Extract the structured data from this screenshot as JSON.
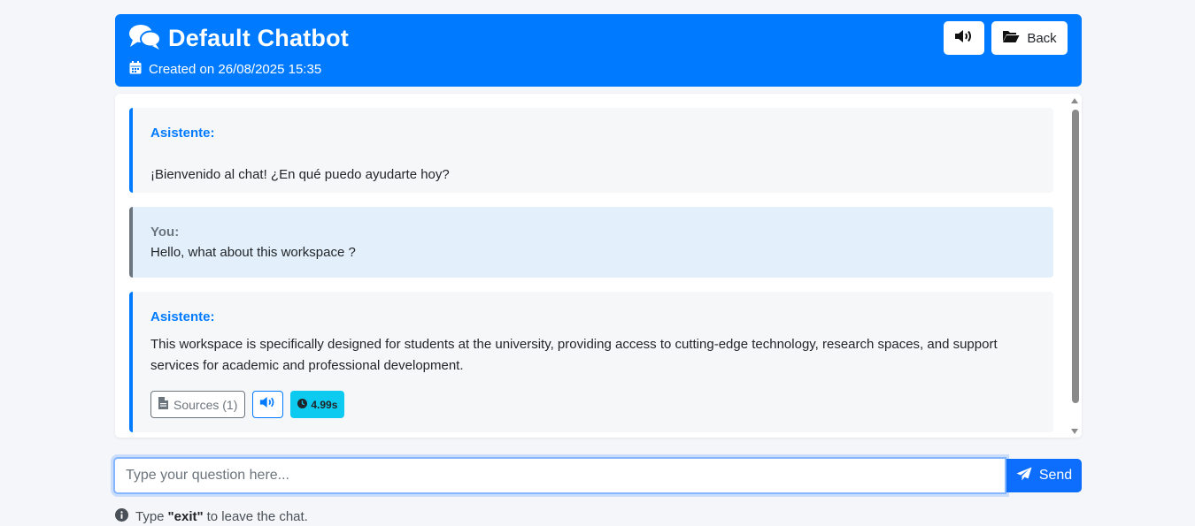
{
  "header": {
    "title": "Default Chatbot",
    "created": "Created on 26/08/2025 15:35",
    "back_label": "Back",
    "icons": [
      "comments-icon",
      "calendar-icon",
      "volume-icon",
      "folder-open-icon"
    ]
  },
  "messages": [
    {
      "role": "bot",
      "author": "Asistente:",
      "text": "¡Bienvenido al chat! ¿En qué puedo ayudarte hoy?"
    },
    {
      "role": "user",
      "author": "You:",
      "text": "Hello, what about this workspace ?"
    },
    {
      "role": "bot",
      "author": "Asistente:",
      "text": "This workspace is specifically designed for students at the university, providing access to cutting-edge technology, research spaces, and support services for academic and professional development.",
      "actions": {
        "sources_label": "Sources (1)",
        "time": "4.99s"
      }
    }
  ],
  "input": {
    "placeholder": "Type your question here...",
    "value": "",
    "send_label": "Send"
  },
  "hint": {
    "prefix": "Type",
    "keyword": "\"exit\"",
    "suffix": "to leave the chat."
  },
  "colors": {
    "primary": "#007bff",
    "badge": "#0dcaf0",
    "user_bg": "#e3f0fb",
    "bot_bg": "#f6f7f9"
  }
}
